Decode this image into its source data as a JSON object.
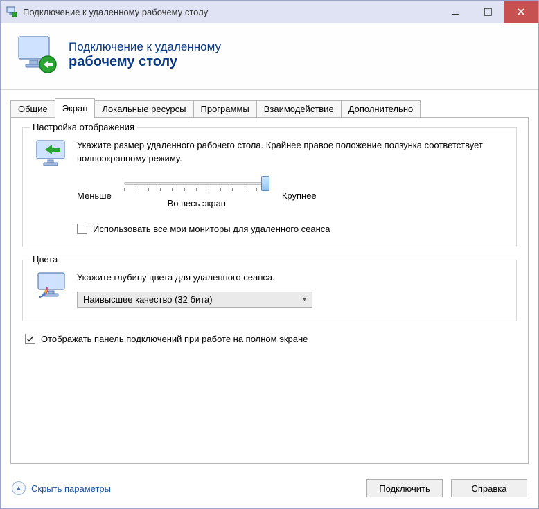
{
  "window": {
    "title": "Подключение к удаленному рабочему столу"
  },
  "banner": {
    "line1": "Подключение к удаленному",
    "line2": "рабочему столу"
  },
  "tabs": [
    "Общие",
    "Экран",
    "Локальные ресурсы",
    "Программы",
    "Взаимодействие",
    "Дополнительно"
  ],
  "active_tab_index": 1,
  "display_group": {
    "title": "Настройка отображения",
    "description": "Укажите размер удаленного рабочего стола. Крайнее правое положение ползунка соответствует полноэкранному режиму.",
    "slider_min_label": "Меньше",
    "slider_max_label": "Крупнее",
    "slider_value_label": "Во весь экран",
    "use_all_monitors_label": "Использовать все мои мониторы для удаленного сеанса",
    "use_all_monitors_checked": false
  },
  "colors_group": {
    "title": "Цвета",
    "description": "Укажите глубину цвета для удаленного сеанса.",
    "depth_selected": "Наивысшее качество (32 бита)"
  },
  "show_connection_bar": {
    "label": "Отображать панель подключений при работе на полном экране",
    "checked": true
  },
  "footer": {
    "hide_options": "Скрыть параметры",
    "connect": "Подключить",
    "help": "Справка"
  }
}
